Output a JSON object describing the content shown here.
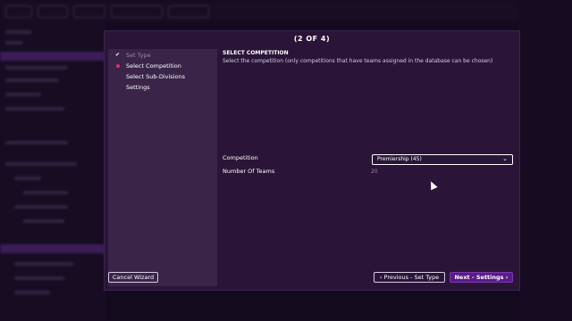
{
  "dialog": {
    "title": "(2 OF 4)",
    "steps": [
      {
        "label": "Set Type",
        "state": "done"
      },
      {
        "label": "Select Competition",
        "state": "current"
      },
      {
        "label": "Select Sub-Divisions",
        "state": "upcoming"
      },
      {
        "label": "Settings",
        "state": "upcoming"
      }
    ],
    "section_title": "SELECT COMPETITION",
    "section_description": "Select the competition (only competitions that have teams assigned in the database can be chosen)",
    "competition_label": "Competition",
    "competition_value": "Premiership (45)",
    "teams_label": "Number Of Teams",
    "teams_value": "20",
    "buttons": {
      "cancel": "Cancel Wizard",
      "previous": "Previous - Set Type",
      "next": "Next - Settings"
    }
  },
  "icons": {
    "check": "check-icon",
    "current": "current-step-dot-icon",
    "chevron": "chevron-down-icon",
    "prev": "chevron-left-icon",
    "next": "chevron-right-icon"
  },
  "colors": {
    "dialog_bg": "#2a1538",
    "steps_panel_bg": "#3a2549",
    "primary_button": "#5a1a8a",
    "current_step_dot": "#e0306a"
  }
}
